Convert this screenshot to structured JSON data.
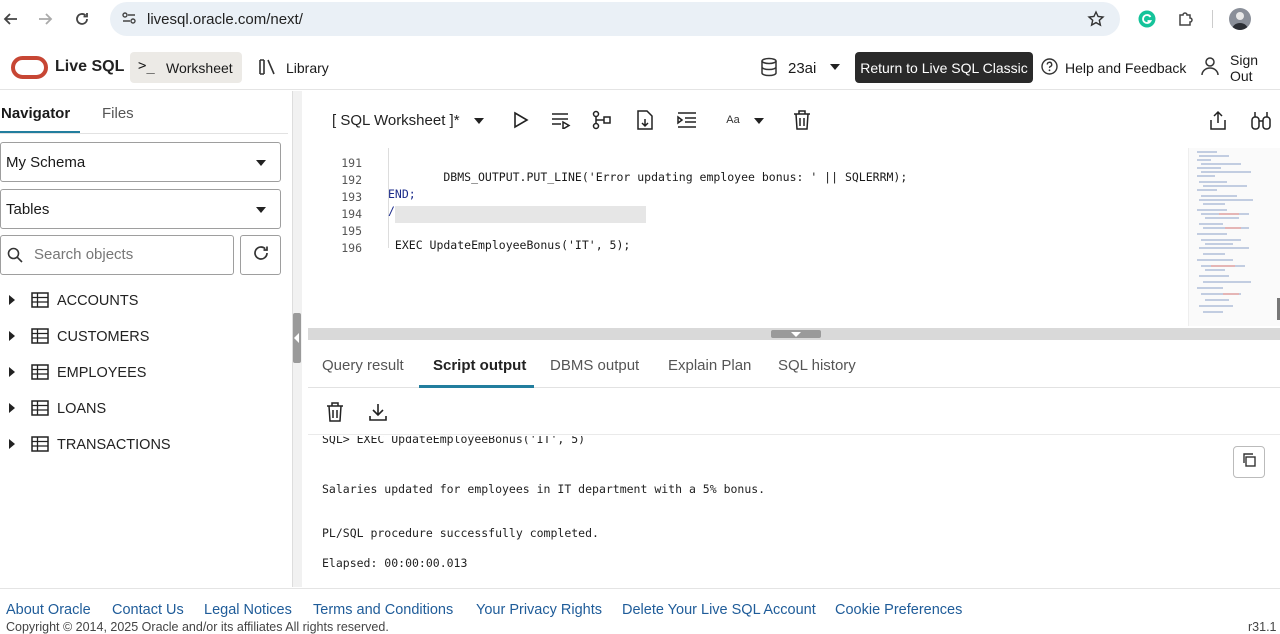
{
  "browser": {
    "url": "livesql.oracle.com/next/"
  },
  "header": {
    "app_name": "Live SQL",
    "worksheet_label": "Worksheet",
    "library_label": "Library",
    "db_version": "23ai",
    "return_label": "Return to Live SQL Classic",
    "help_label": "Help and Feedback",
    "signout_label": "Sign Out"
  },
  "navigator": {
    "tabs": [
      {
        "label": "Navigator",
        "active": true
      },
      {
        "label": "Files",
        "active": false
      }
    ],
    "schema_select": "My Schema",
    "type_select": "Tables",
    "search_placeholder": "Search objects",
    "tables": [
      "ACCOUNTS",
      "CUSTOMERS",
      "EMPLOYEES",
      "LOANS",
      "TRANSACTIONS"
    ]
  },
  "editor": {
    "title": "[ SQL Worksheet ]*",
    "font_label": "Aa",
    "lines": [
      {
        "num": "191",
        "text": "        DBMS_OUTPUT.PUT_LINE('Error updating employee bonus: ' || SQLERRM);"
      },
      {
        "num": "192",
        "text": "END;"
      },
      {
        "num": "193",
        "text": "/"
      },
      {
        "num": "194",
        "text": ""
      },
      {
        "num": "195",
        "text": " EXEC UpdateEmployeeBonus('IT', 5);"
      },
      {
        "num": "196",
        "text": ""
      }
    ]
  },
  "output": {
    "tabs": [
      {
        "label": "Query result",
        "active": false
      },
      {
        "label": "Script output",
        "active": true
      },
      {
        "label": "DBMS output",
        "active": false
      },
      {
        "label": "Explain Plan",
        "active": false
      },
      {
        "label": "SQL history",
        "active": false
      }
    ],
    "lines": [
      "SQL> EXEC UpdateEmployeeBonus('IT', 5)",
      "Salaries updated for employees in IT department with a 5% bonus.",
      "PL/SQL procedure successfully completed.",
      "Elapsed: 00:00:00.013"
    ]
  },
  "footer": {
    "links": [
      "About Oracle",
      "Contact Us",
      "Legal Notices",
      "Terms and Conditions",
      "Your Privacy Rights",
      "Delete Your Live SQL Account",
      "Cookie Preferences"
    ],
    "copyright": "Copyright © 2014, 2025 Oracle and/or its affiliates All rights reserved.",
    "version": "r31.1"
  },
  "colors": {
    "accent": "#227e9e",
    "oracle_red": "#c74634",
    "link": "#1f5c99"
  }
}
